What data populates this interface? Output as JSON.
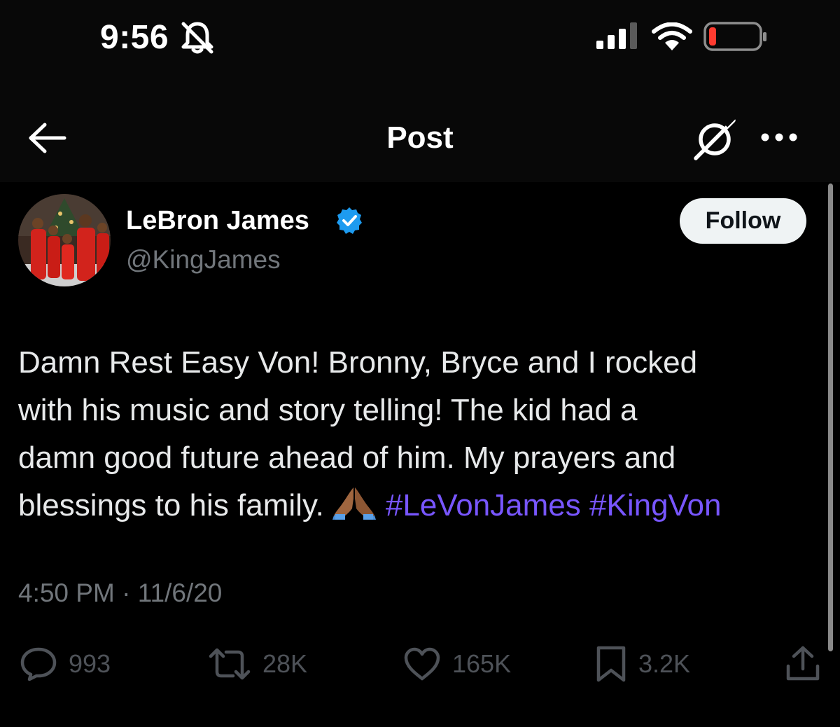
{
  "status_bar": {
    "time": "9:56"
  },
  "nav": {
    "title": "Post"
  },
  "author": {
    "name": "LeBron James",
    "handle": "@KingJames",
    "follow_label": "Follow"
  },
  "tweet": {
    "line1": "Damn Rest Easy Von! Bronny, Bryce and I rocked",
    "line2": "with his music and story telling! The kid had a",
    "line3": "damn good future ahead of him. My prayers and",
    "line4_text": "blessings to his family.",
    "emoji": "🙏🏾",
    "hashtag1": "#LeVonJames",
    "hashtag2": "#KingVon"
  },
  "meta": {
    "time": "4:50 PM",
    "separator": "·",
    "date": "11/6/20"
  },
  "actions": {
    "replies": "993",
    "reposts": "28K",
    "likes": "165K",
    "bookmarks": "3.2K"
  },
  "colors": {
    "background": "#000000",
    "hashtag": "#7856ff",
    "verified": "#1d9bf0",
    "battery_low": "#ff3b30"
  },
  "icons": [
    "bell-slash-icon",
    "signal-icon",
    "wifi-icon",
    "battery-icon",
    "back-arrow-icon",
    "grok-icon",
    "more-icon",
    "verified-badge-icon",
    "reply-icon",
    "repost-icon",
    "like-icon",
    "bookmark-icon",
    "share-icon"
  ]
}
